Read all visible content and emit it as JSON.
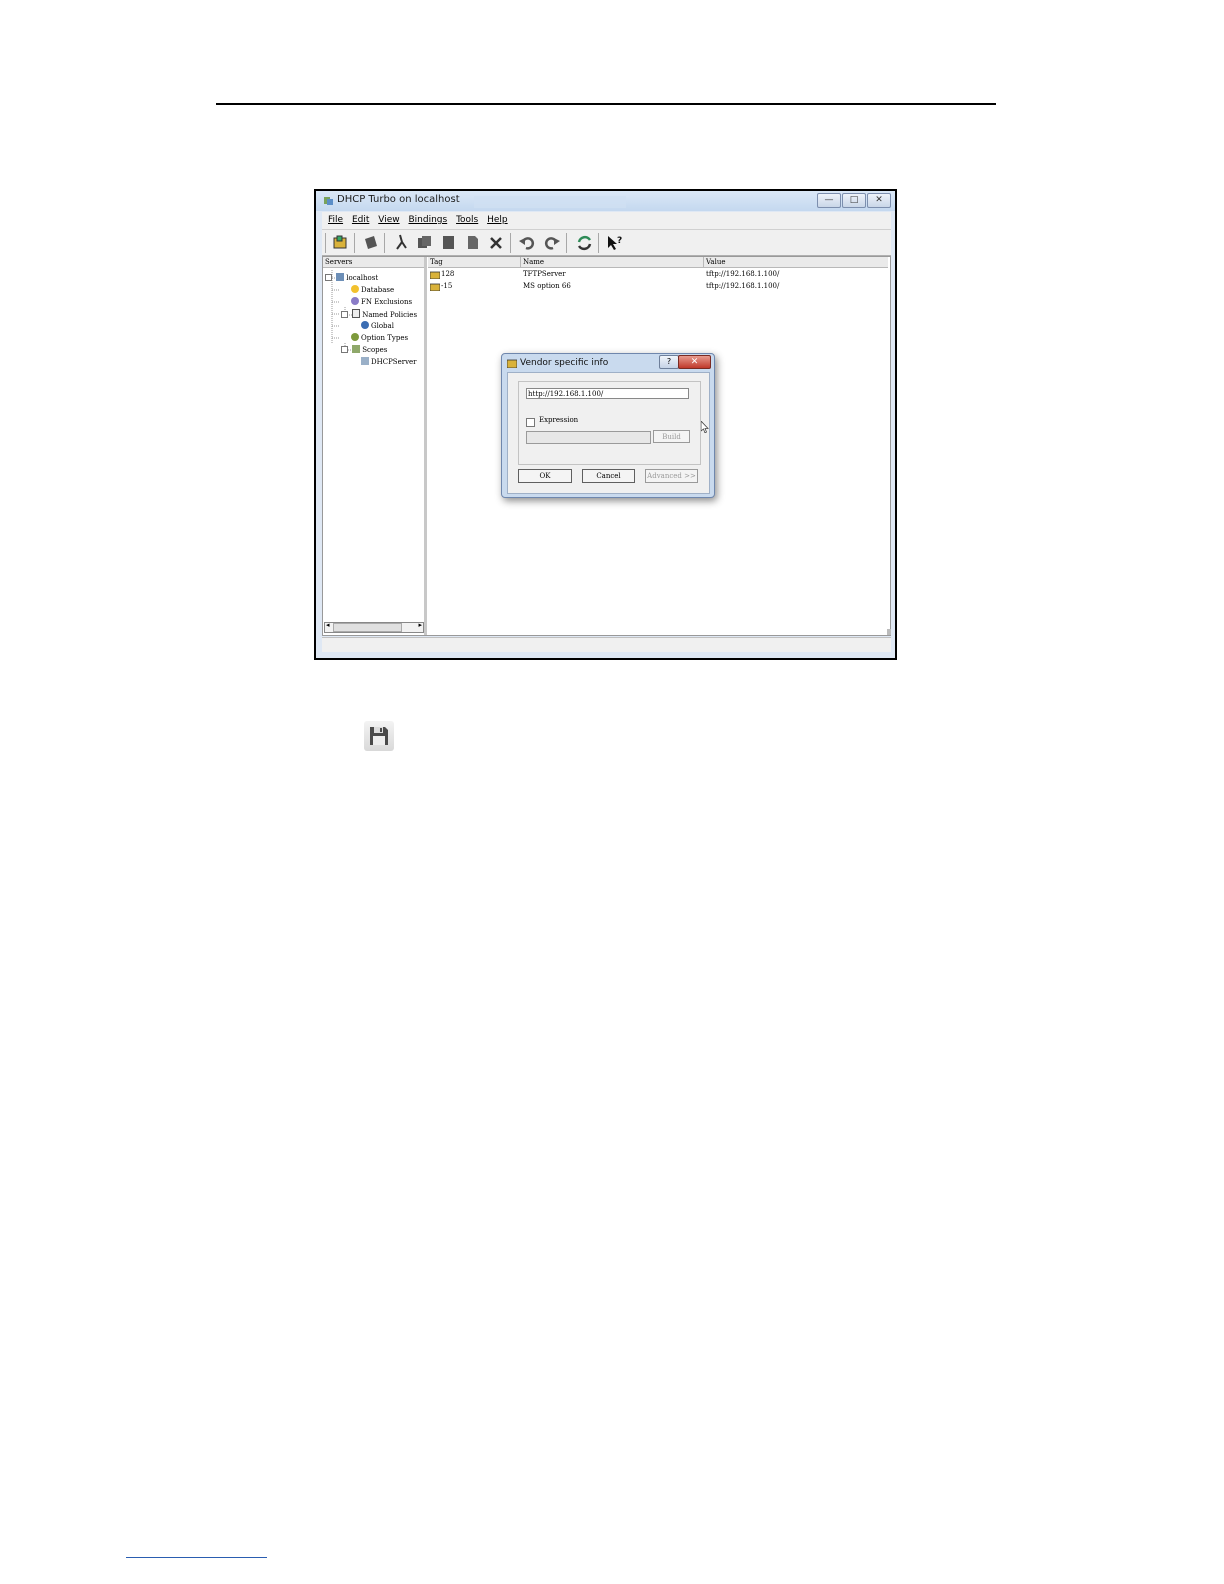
{
  "window": {
    "title": "DHCP Turbo on localhost",
    "buttons": {
      "minimize": "—",
      "maximize": "□",
      "close": "✕"
    }
  },
  "menubar": {
    "items": [
      "File",
      "Edit",
      "View",
      "Bindings",
      "Tools",
      "Help"
    ]
  },
  "toolbar": {
    "icons": [
      "new-server-icon",
      "stop-icon",
      "cut-icon",
      "copy-icon",
      "paste-icon",
      "document-icon",
      "properties-icon",
      "undo-icon",
      "redo-icon",
      "refresh-icon",
      "context-help-icon"
    ]
  },
  "left_pane": {
    "header": "Servers",
    "tree": [
      {
        "label": "localhost",
        "icon": "server-icon"
      },
      {
        "label": "Database",
        "icon": "database-icon"
      },
      {
        "label": "FN Exclusions",
        "icon": "exclusions-icon"
      },
      {
        "label": "Named Policies",
        "icon": "policies-icon"
      },
      {
        "label": "Global",
        "icon": "global-icon"
      },
      {
        "label": "Option Types",
        "icon": "option-types-icon"
      },
      {
        "label": "Scopes",
        "icon": "scopes-icon"
      },
      {
        "label": "DHCPServer",
        "icon": "scope-server-icon"
      }
    ]
  },
  "right_pane": {
    "columns": [
      "Tag",
      "Name",
      "Value"
    ],
    "rows": [
      {
        "tag": "128",
        "name": "TFTPServer",
        "value": "tftp://192.168.1.100/"
      },
      {
        "tag": "-15",
        "name": "MS option 66",
        "value": "tftp://192.168.1.100/"
      }
    ]
  },
  "dialog": {
    "title": "Vendor specific info",
    "help_label": "?",
    "close_label": "✕",
    "url_value": "http://192.168.1.100/",
    "expression_label": "Expression",
    "build_label": "Build",
    "ok_label": "OK",
    "cancel_label": "Cancel",
    "advanced_label": "Advanced >>"
  },
  "standalone_icon": "save-icon"
}
